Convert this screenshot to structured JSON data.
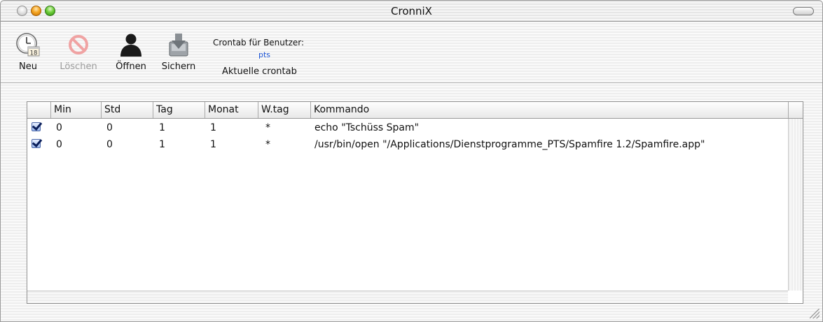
{
  "window": {
    "title": "CronniX"
  },
  "toolbar": {
    "items": [
      {
        "label": "Neu",
        "icon": "clock-calendar-icon",
        "enabled": true,
        "badge": "18"
      },
      {
        "label": "Löschen",
        "icon": "no-entry-icon",
        "enabled": false
      },
      {
        "label": "Öffnen",
        "icon": "user-silhouette-icon",
        "enabled": true
      },
      {
        "label": "Sichern",
        "icon": "disk-save-icon",
        "enabled": true
      }
    ],
    "crontab_caption": "Crontab für Benutzer:",
    "crontab_user": "pts",
    "crontab_current": "Aktuelle crontab"
  },
  "table": {
    "columns": [
      "",
      "Min",
      "Std",
      "Tag",
      "Monat",
      "W.tag",
      "Kommando"
    ],
    "rows": [
      {
        "enabled": true,
        "min": "0",
        "std": "0",
        "tag": "1",
        "monat": "1",
        "wtag": "*",
        "kommando": "echo \"Tschüss Spam\""
      },
      {
        "enabled": true,
        "min": "0",
        "std": "0",
        "tag": "1",
        "monat": "1",
        "wtag": "*",
        "kommando": "/usr/bin/open \"/Applications/Dienstprogramme_PTS/Spamfire 1.2/Spamfire.app\""
      }
    ]
  },
  "colors": {
    "accent": "#1d55d6",
    "disabled_text": "#9c9c9c"
  }
}
